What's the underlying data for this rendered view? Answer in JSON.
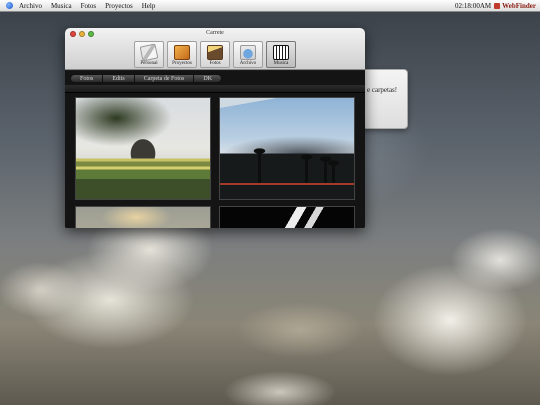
{
  "menubar": {
    "items": [
      "Archivo",
      "Musica",
      "Fotos",
      "Proyectos",
      "Help"
    ],
    "clock": "02:18:00AM",
    "app_name": "WebFinder"
  },
  "background_dialog": {
    "text": "e carpetas!"
  },
  "window": {
    "title": "Carrete",
    "toolbar": [
      {
        "label": "Personal",
        "icon": "personal-icon"
      },
      {
        "label": "Proyectos",
        "icon": "proyectos-icon"
      },
      {
        "label": "Fotos",
        "icon": "fotos-icon"
      },
      {
        "label": "Archivo",
        "icon": "archivo-icon"
      },
      {
        "label": "Musica",
        "icon": "musica-icon"
      }
    ],
    "tabs": [
      "Fotos",
      "Edits",
      "Carpeta de Fotos",
      "DK"
    ]
  }
}
